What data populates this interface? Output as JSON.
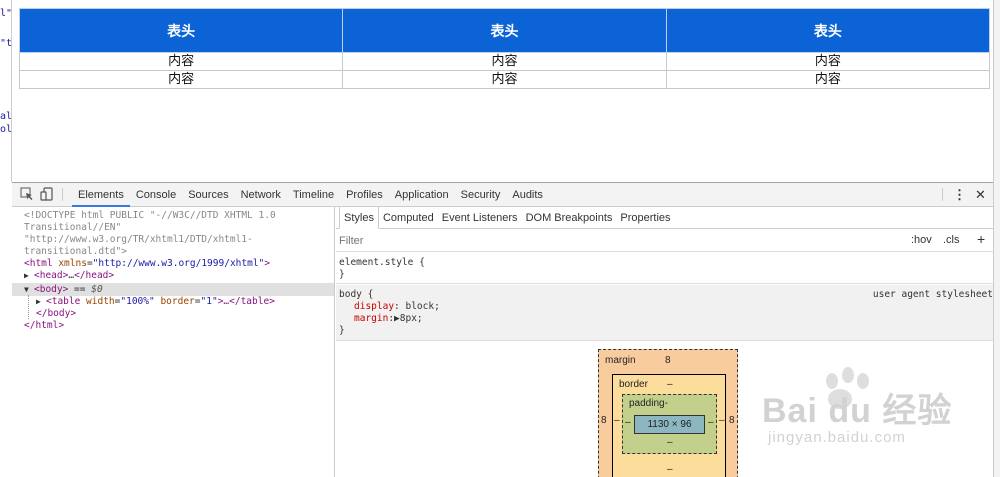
{
  "left_strip": {
    "lines": [
      "l\"",
      "\"t",
      "al",
      "ol"
    ]
  },
  "preview_table": {
    "headers": [
      "表头",
      "表头",
      "表头"
    ],
    "rows": [
      [
        "内容",
        "内容",
        "内容"
      ],
      [
        "内容",
        "内容",
        "内容"
      ]
    ],
    "header_color": "#0b63d6"
  },
  "devtools": {
    "toolbar": {
      "tabs": [
        "Elements",
        "Console",
        "Sources",
        "Network",
        "Timeline",
        "Profiles",
        "Application",
        "Security",
        "Audits"
      ],
      "active_tab": "Elements",
      "menu_glyph": "⋮",
      "close_glyph": "✕",
      "icons": [
        "inspect-icon",
        "device-mode-icon",
        "kebab-menu-icon",
        "close-icon"
      ]
    },
    "elements": {
      "doctype1": "<!DOCTYPE html PUBLIC \"-//W3C//DTD XHTML 1.0",
      "doctype2": "Transitional//EN\"",
      "doctype3": "\"http://www.w3.org/TR/xhtml1/DTD/xhtml1-",
      "doctype4": "transitional.dtd\">",
      "html_open_tag": "<html ",
      "html_attr": "xmlns",
      "html_eq": "=",
      "html_val": "\"http://www.w3.org/1999/xhtml\"",
      "html_close": ">",
      "head_tag": "<head>",
      "head_ellipsis": "…",
      "head_close": "</head>",
      "body_tag": "<body>",
      "body_eq": " == ",
      "body_ref": "$0",
      "table_tag": "<table ",
      "table_attr1": "width",
      "table_val1": "\"100%\"",
      "table_attr2": "border",
      "table_val2": "\"1\"",
      "table_rest": ">…</table>",
      "body_close": "</body>",
      "html_close_tag": "</html>"
    },
    "styles": {
      "subtabs": [
        "Styles",
        "Computed",
        "Event Listeners",
        "DOM Breakpoints",
        "Properties"
      ],
      "active_subtab": "Styles",
      "filter_placeholder": "Filter",
      "hov": ":hov",
      "cls": ".cls",
      "plus": "+",
      "element_style_selector": "element.style {",
      "close_brace": "}",
      "body_selector": "body {",
      "ua_label": "user agent stylesheet",
      "display_prop": "display",
      "display_val": ": block;",
      "margin_prop": "margin",
      "margin_val": ":▶8px;"
    },
    "box_model": {
      "margin_label": "margin",
      "margin_top": "8",
      "margin_left": "8",
      "margin_right": "8",
      "border_label": "border",
      "border_top": "–",
      "border_left": "–",
      "border_right": "–",
      "border_bottom": "–",
      "padding_label": "padding-",
      "padding_left": "–",
      "padding_right": "–",
      "padding_bottom": "–",
      "content": "1130 × 96",
      "margin_bottom": "–"
    }
  },
  "watermark": {
    "brand": "Bai du 经验",
    "url": "jingyan.baidu.com"
  }
}
